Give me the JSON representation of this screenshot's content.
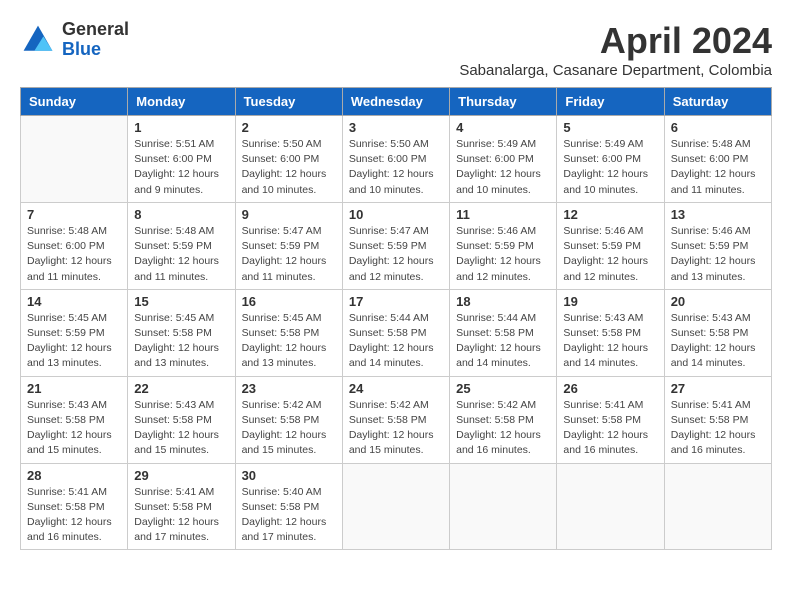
{
  "header": {
    "logo": {
      "general": "General",
      "blue": "Blue"
    },
    "title": "April 2024",
    "subtitle": "Sabanalarga, Casanare Department, Colombia"
  },
  "days_of_week": [
    "Sunday",
    "Monday",
    "Tuesday",
    "Wednesday",
    "Thursday",
    "Friday",
    "Saturday"
  ],
  "weeks": [
    [
      {
        "day": null
      },
      {
        "day": 1,
        "sunrise": "5:51 AM",
        "sunset": "6:00 PM",
        "daylight": "12 hours and 9 minutes."
      },
      {
        "day": 2,
        "sunrise": "5:50 AM",
        "sunset": "6:00 PM",
        "daylight": "12 hours and 10 minutes."
      },
      {
        "day": 3,
        "sunrise": "5:50 AM",
        "sunset": "6:00 PM",
        "daylight": "12 hours and 10 minutes."
      },
      {
        "day": 4,
        "sunrise": "5:49 AM",
        "sunset": "6:00 PM",
        "daylight": "12 hours and 10 minutes."
      },
      {
        "day": 5,
        "sunrise": "5:49 AM",
        "sunset": "6:00 PM",
        "daylight": "12 hours and 10 minutes."
      },
      {
        "day": 6,
        "sunrise": "5:48 AM",
        "sunset": "6:00 PM",
        "daylight": "12 hours and 11 minutes."
      }
    ],
    [
      {
        "day": 7,
        "sunrise": "5:48 AM",
        "sunset": "6:00 PM",
        "daylight": "12 hours and 11 minutes."
      },
      {
        "day": 8,
        "sunrise": "5:48 AM",
        "sunset": "5:59 PM",
        "daylight": "12 hours and 11 minutes."
      },
      {
        "day": 9,
        "sunrise": "5:47 AM",
        "sunset": "5:59 PM",
        "daylight": "12 hours and 11 minutes."
      },
      {
        "day": 10,
        "sunrise": "5:47 AM",
        "sunset": "5:59 PM",
        "daylight": "12 hours and 12 minutes."
      },
      {
        "day": 11,
        "sunrise": "5:46 AM",
        "sunset": "5:59 PM",
        "daylight": "12 hours and 12 minutes."
      },
      {
        "day": 12,
        "sunrise": "5:46 AM",
        "sunset": "5:59 PM",
        "daylight": "12 hours and 12 minutes."
      },
      {
        "day": 13,
        "sunrise": "5:46 AM",
        "sunset": "5:59 PM",
        "daylight": "12 hours and 13 minutes."
      }
    ],
    [
      {
        "day": 14,
        "sunrise": "5:45 AM",
        "sunset": "5:59 PM",
        "daylight": "12 hours and 13 minutes."
      },
      {
        "day": 15,
        "sunrise": "5:45 AM",
        "sunset": "5:58 PM",
        "daylight": "12 hours and 13 minutes."
      },
      {
        "day": 16,
        "sunrise": "5:45 AM",
        "sunset": "5:58 PM",
        "daylight": "12 hours and 13 minutes."
      },
      {
        "day": 17,
        "sunrise": "5:44 AM",
        "sunset": "5:58 PM",
        "daylight": "12 hours and 14 minutes."
      },
      {
        "day": 18,
        "sunrise": "5:44 AM",
        "sunset": "5:58 PM",
        "daylight": "12 hours and 14 minutes."
      },
      {
        "day": 19,
        "sunrise": "5:43 AM",
        "sunset": "5:58 PM",
        "daylight": "12 hours and 14 minutes."
      },
      {
        "day": 20,
        "sunrise": "5:43 AM",
        "sunset": "5:58 PM",
        "daylight": "12 hours and 14 minutes."
      }
    ],
    [
      {
        "day": 21,
        "sunrise": "5:43 AM",
        "sunset": "5:58 PM",
        "daylight": "12 hours and 15 minutes."
      },
      {
        "day": 22,
        "sunrise": "5:43 AM",
        "sunset": "5:58 PM",
        "daylight": "12 hours and 15 minutes."
      },
      {
        "day": 23,
        "sunrise": "5:42 AM",
        "sunset": "5:58 PM",
        "daylight": "12 hours and 15 minutes."
      },
      {
        "day": 24,
        "sunrise": "5:42 AM",
        "sunset": "5:58 PM",
        "daylight": "12 hours and 15 minutes."
      },
      {
        "day": 25,
        "sunrise": "5:42 AM",
        "sunset": "5:58 PM",
        "daylight": "12 hours and 16 minutes."
      },
      {
        "day": 26,
        "sunrise": "5:41 AM",
        "sunset": "5:58 PM",
        "daylight": "12 hours and 16 minutes."
      },
      {
        "day": 27,
        "sunrise": "5:41 AM",
        "sunset": "5:58 PM",
        "daylight": "12 hours and 16 minutes."
      }
    ],
    [
      {
        "day": 28,
        "sunrise": "5:41 AM",
        "sunset": "5:58 PM",
        "daylight": "12 hours and 16 minutes."
      },
      {
        "day": 29,
        "sunrise": "5:41 AM",
        "sunset": "5:58 PM",
        "daylight": "12 hours and 17 minutes."
      },
      {
        "day": 30,
        "sunrise": "5:40 AM",
        "sunset": "5:58 PM",
        "daylight": "12 hours and 17 minutes."
      },
      {
        "day": null
      },
      {
        "day": null
      },
      {
        "day": null
      },
      {
        "day": null
      }
    ]
  ],
  "colors": {
    "header_bg": "#1565c0",
    "logo_blue": "#1565c0"
  }
}
